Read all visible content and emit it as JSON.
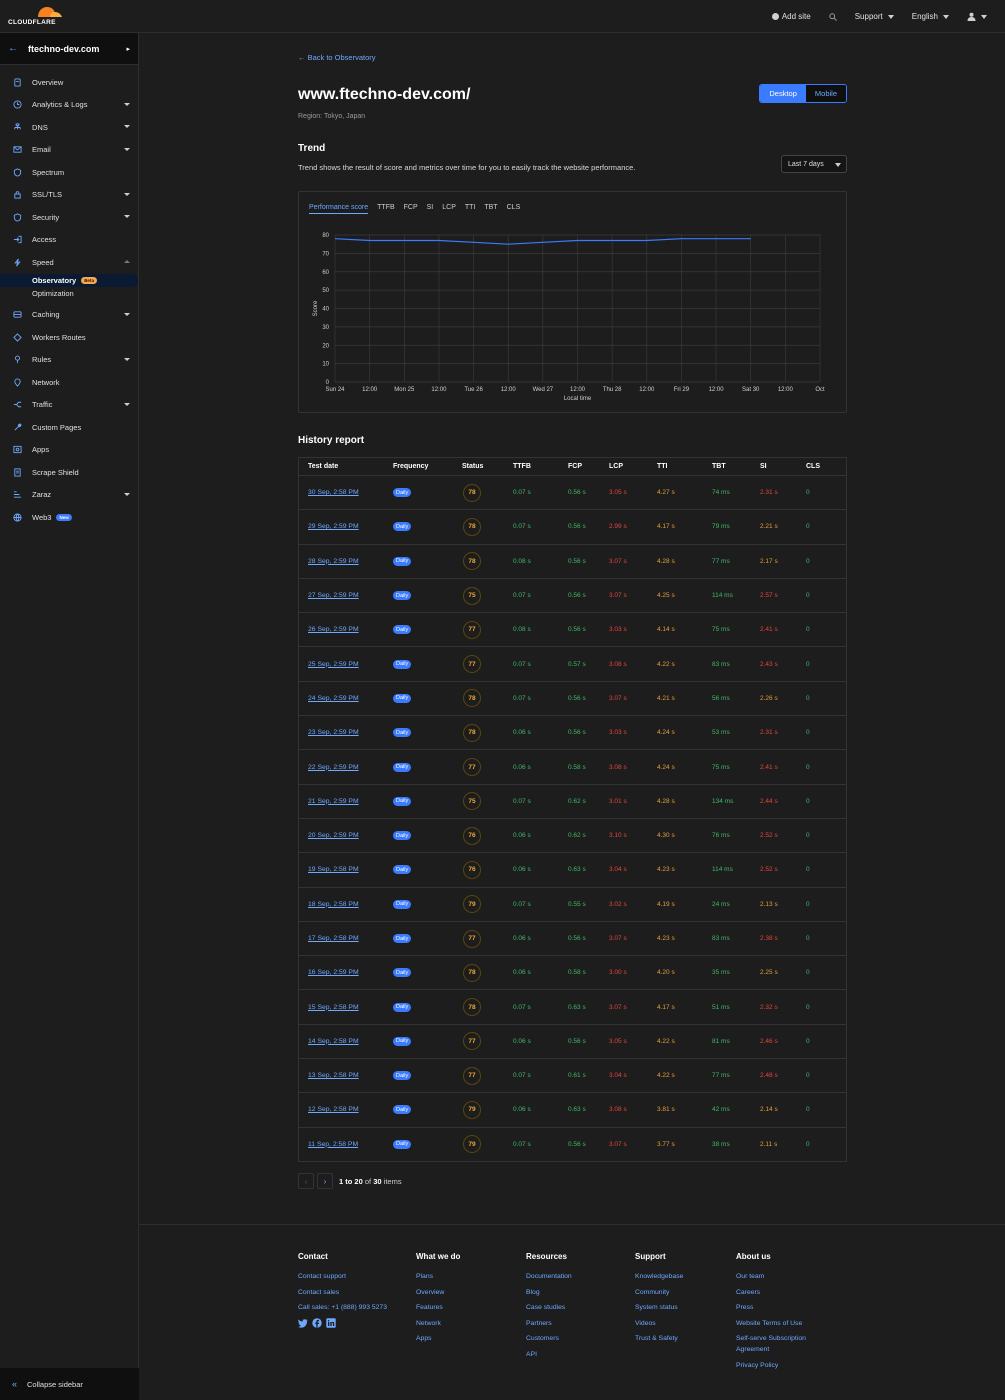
{
  "brand": {
    "logo_text": "CLOUDFLARE",
    "accent": "#f6821f",
    "link": "#6ea8ff",
    "primary": "#3a7bff"
  },
  "topbar": {
    "add_site": "Add site",
    "support": "Support",
    "language": "English"
  },
  "sidebar": {
    "zone": "ftechno-dev.com",
    "items": [
      {
        "label": "Overview",
        "icon": "document-icon",
        "dropdown": false
      },
      {
        "label": "Analytics & Logs",
        "icon": "clock-icon",
        "dropdown": true
      },
      {
        "label": "DNS",
        "icon": "network-tree-icon",
        "dropdown": true
      },
      {
        "label": "Email",
        "icon": "email-icon",
        "dropdown": true
      },
      {
        "label": "Spectrum",
        "icon": "shield-icon",
        "dropdown": false
      },
      {
        "label": "SSL/TLS",
        "icon": "lock-icon",
        "dropdown": true
      },
      {
        "label": "Security",
        "icon": "shield-icon",
        "dropdown": true
      },
      {
        "label": "Access",
        "icon": "access-icon",
        "dropdown": false
      },
      {
        "label": "Speed",
        "icon": "bolt-icon",
        "dropdown": "open"
      }
    ],
    "speed_sub": [
      {
        "label": "Observatory",
        "badge": "Beta",
        "active": true
      },
      {
        "label": "Optimization",
        "active": false
      }
    ],
    "items2": [
      {
        "label": "Caching",
        "icon": "storage-icon",
        "dropdown": true
      },
      {
        "label": "Workers Routes",
        "icon": "workers-icon",
        "dropdown": false
      },
      {
        "label": "Rules",
        "icon": "rules-icon",
        "dropdown": true
      },
      {
        "label": "Network",
        "icon": "pin-icon",
        "dropdown": false
      },
      {
        "label": "Traffic",
        "icon": "traffic-icon",
        "dropdown": true
      },
      {
        "label": "Custom Pages",
        "icon": "wrench-icon",
        "dropdown": false
      },
      {
        "label": "Apps",
        "icon": "apps-icon",
        "dropdown": false
      },
      {
        "label": "Scrape Shield",
        "icon": "scrape-icon",
        "dropdown": false
      },
      {
        "label": "Zaraz",
        "icon": "zaraz-icon",
        "dropdown": true
      },
      {
        "label": "Web3",
        "icon": "web3-icon",
        "dropdown": false,
        "badge": "New"
      }
    ],
    "collapse": "Collapse sidebar"
  },
  "page": {
    "back": "← Back to Observatory",
    "title": "www.ftechno-dev.com/",
    "region": "Region: Tokyo, Japan",
    "device_tabs": [
      "Desktop",
      "Mobile"
    ],
    "trend_title": "Trend",
    "trend_desc": "Trend shows the result of score and metrics over time for you to easily track the website performance.",
    "range": "Last 7 days",
    "history_title": "History report"
  },
  "chart_data": {
    "type": "line",
    "tabs": [
      "Performance score",
      "TTFB",
      "FCP",
      "SI",
      "LCP",
      "TTI",
      "TBT",
      "CLS"
    ],
    "selected_tab": "Performance score",
    "ylabel": "Score",
    "xlabel": "Local time",
    "ylim": [
      0,
      80
    ],
    "yticks": [
      0,
      10,
      20,
      30,
      40,
      50,
      60,
      70,
      80
    ],
    "xticks": [
      "Sun 24",
      "12:00",
      "Mon 25",
      "12:00",
      "Tue 26",
      "12:00",
      "Wed 27",
      "12:00",
      "Thu 28",
      "12:00",
      "Fri 29",
      "12:00",
      "Sat 30",
      "12:00",
      "Oct"
    ],
    "series": [
      {
        "x": [
          0,
          0.5,
          1,
          1.5,
          2,
          2.5,
          3,
          3.5,
          4,
          4.5,
          5,
          5.5,
          6
        ],
        "values": [
          78,
          77,
          77,
          77,
          76,
          75,
          76,
          77,
          77,
          77,
          78,
          78,
          78
        ]
      }
    ],
    "grid": true
  },
  "table": {
    "headers": [
      "Test date",
      "Frequency",
      "Status",
      "TTFB",
      "FCP",
      "LCP",
      "TTI",
      "TBT",
      "SI",
      "CLS"
    ],
    "rows": [
      {
        "date": "30 Sep, 2:58 PM",
        "freq": "Daily",
        "score": "78",
        "ttfb": "0.07 s",
        "fcp": "0.56 s",
        "lcp": "3.05 s",
        "tti": "4.27 s",
        "tbt": "74 ms",
        "si": "2.31 s",
        "cls": "0",
        "tbt_c": "g",
        "si_c": "r"
      },
      {
        "date": "29 Sep, 2:59 PM",
        "freq": "Daily",
        "score": "78",
        "ttfb": "0.07 s",
        "fcp": "0.56 s",
        "lcp": "2.99 s",
        "tti": "4.17 s",
        "tbt": "79 ms",
        "si": "2.21 s",
        "cls": "0",
        "tbt_c": "g",
        "si_c": "o"
      },
      {
        "date": "28 Sep, 2:59 PM",
        "freq": "Daily",
        "score": "78",
        "ttfb": "0.08 s",
        "fcp": "0.56 s",
        "lcp": "3.07 s",
        "tti": "4.28 s",
        "tbt": "77 ms",
        "si": "2.17 s",
        "cls": "0",
        "tbt_c": "g",
        "si_c": "o"
      },
      {
        "date": "27 Sep, 2:59 PM",
        "freq": "Daily",
        "score": "75",
        "ttfb": "0.07 s",
        "fcp": "0.56 s",
        "lcp": "3.07 s",
        "tti": "4.25 s",
        "tbt": "114 ms",
        "si": "2.57 s",
        "cls": "0",
        "tbt_c": "g",
        "si_c": "r"
      },
      {
        "date": "26 Sep, 2:59 PM",
        "freq": "Daily",
        "score": "77",
        "ttfb": "0.08 s",
        "fcp": "0.56 s",
        "lcp": "3.03 s",
        "tti": "4.14 s",
        "tbt": "75 ms",
        "si": "2.41 s",
        "cls": "0",
        "tbt_c": "g",
        "si_c": "r"
      },
      {
        "date": "25 Sep, 2:59 PM",
        "freq": "Daily",
        "score": "77",
        "ttfb": "0.07 s",
        "fcp": "0.57 s",
        "lcp": "3.08 s",
        "tti": "4.22 s",
        "tbt": "83 ms",
        "si": "2.43 s",
        "cls": "0",
        "tbt_c": "g",
        "si_c": "r"
      },
      {
        "date": "24 Sep, 2:59 PM",
        "freq": "Daily",
        "score": "78",
        "ttfb": "0.07 s",
        "fcp": "0.56 s",
        "lcp": "3.07 s",
        "tti": "4.21 s",
        "tbt": "56 ms",
        "si": "2.26 s",
        "cls": "0",
        "tbt_c": "g",
        "si_c": "o"
      },
      {
        "date": "23 Sep, 2:59 PM",
        "freq": "Daily",
        "score": "78",
        "ttfb": "0.06 s",
        "fcp": "0.56 s",
        "lcp": "3.03 s",
        "tti": "4.24 s",
        "tbt": "53 ms",
        "si": "2.31 s",
        "cls": "0",
        "tbt_c": "g",
        "si_c": "r"
      },
      {
        "date": "22 Sep, 2:59 PM",
        "freq": "Daily",
        "score": "77",
        "ttfb": "0.06 s",
        "fcp": "0.58 s",
        "lcp": "3.08 s",
        "tti": "4.24 s",
        "tbt": "75 ms",
        "si": "2.41 s",
        "cls": "0",
        "tbt_c": "g",
        "si_c": "r"
      },
      {
        "date": "21 Sep, 2:59 PM",
        "freq": "Daily",
        "score": "75",
        "ttfb": "0.07 s",
        "fcp": "0.62 s",
        "lcp": "3.01 s",
        "tti": "4.28 s",
        "tbt": "134 ms",
        "si": "2.44 s",
        "cls": "0",
        "tbt_c": "g",
        "si_c": "r"
      },
      {
        "date": "20 Sep, 2:59 PM",
        "freq": "Daily",
        "score": "76",
        "ttfb": "0.06 s",
        "fcp": "0.62 s",
        "lcp": "3.10 s",
        "tti": "4.30 s",
        "tbt": "76 ms",
        "si": "2.52 s",
        "cls": "0",
        "tbt_c": "g",
        "si_c": "r"
      },
      {
        "date": "19 Sep, 2:58 PM",
        "freq": "Daily",
        "score": "76",
        "ttfb": "0.06 s",
        "fcp": "0.63 s",
        "lcp": "3.04 s",
        "tti": "4.23 s",
        "tbt": "114 ms",
        "si": "2.52 s",
        "cls": "0",
        "tbt_c": "g",
        "si_c": "r"
      },
      {
        "date": "18 Sep, 2:58 PM",
        "freq": "Daily",
        "score": "79",
        "ttfb": "0.07 s",
        "fcp": "0.55 s",
        "lcp": "3.02 s",
        "tti": "4.19 s",
        "tbt": "24 ms",
        "si": "2.13 s",
        "cls": "0",
        "tbt_c": "g",
        "si_c": "o"
      },
      {
        "date": "17 Sep, 2:58 PM",
        "freq": "Daily",
        "score": "77",
        "ttfb": "0.06 s",
        "fcp": "0.56 s",
        "lcp": "3.07 s",
        "tti": "4.23 s",
        "tbt": "83 ms",
        "si": "2.38 s",
        "cls": "0",
        "tbt_c": "g",
        "si_c": "r"
      },
      {
        "date": "16 Sep, 2:59 PM",
        "freq": "Daily",
        "score": "78",
        "ttfb": "0.06 s",
        "fcp": "0.58 s",
        "lcp": "3.00 s",
        "tti": "4.20 s",
        "tbt": "35 ms",
        "si": "2.25 s",
        "cls": "0",
        "tbt_c": "g",
        "si_c": "o"
      },
      {
        "date": "15 Sep, 2:58 PM",
        "freq": "Daily",
        "score": "78",
        "ttfb": "0.07 s",
        "fcp": "0.63 s",
        "lcp": "3.07 s",
        "tti": "4.17 s",
        "tbt": "51 ms",
        "si": "2.32 s",
        "cls": "0",
        "tbt_c": "g",
        "si_c": "r"
      },
      {
        "date": "14 Sep, 2:58 PM",
        "freq": "Daily",
        "score": "77",
        "ttfb": "0.06 s",
        "fcp": "0.56 s",
        "lcp": "3.05 s",
        "tti": "4.22 s",
        "tbt": "81 ms",
        "si": "2.46 s",
        "cls": "0",
        "tbt_c": "g",
        "si_c": "r"
      },
      {
        "date": "13 Sep, 2:58 PM",
        "freq": "Daily",
        "score": "77",
        "ttfb": "0.07 s",
        "fcp": "0.61 s",
        "lcp": "3.04 s",
        "tti": "4.22 s",
        "tbt": "77 ms",
        "si": "2.48 s",
        "cls": "0",
        "tbt_c": "g",
        "si_c": "r"
      },
      {
        "date": "12 Sep, 2:58 PM",
        "freq": "Daily",
        "score": "79",
        "ttfb": "0.06 s",
        "fcp": "0.63 s",
        "lcp": "3.08 s",
        "tti": "3.81 s",
        "tbt": "42 ms",
        "si": "2.14 s",
        "cls": "0",
        "tbt_c": "g",
        "si_c": "o"
      },
      {
        "date": "11 Sep, 2:58 PM",
        "freq": "Daily",
        "score": "79",
        "ttfb": "0.07 s",
        "fcp": "0.56 s",
        "lcp": "3.07 s",
        "tti": "3.77 s",
        "tbt": "38 ms",
        "si": "2.11 s",
        "cls": "0",
        "tbt_c": "g",
        "si_c": "o"
      }
    ]
  },
  "pager": {
    "range": "1 to 20",
    "of": "of",
    "total": "30",
    "suffix": "items"
  },
  "footer": {
    "columns": [
      {
        "title": "Contact",
        "links": [
          "Contact support",
          "Contact sales",
          "Call sales: +1 (888) 993 5273"
        ],
        "social": true
      },
      {
        "title": "What we do",
        "links": [
          "Plans",
          "Overview",
          "Features",
          "Network",
          "Apps"
        ]
      },
      {
        "title": "Resources",
        "links": [
          "Documentation",
          "Blog",
          "Case studies",
          "Partners",
          "Customers",
          "API"
        ]
      },
      {
        "title": "Support",
        "links": [
          "Knowledgebase",
          "Community",
          "System status",
          "Videos",
          "Trust & Safety"
        ]
      },
      {
        "title": "About us",
        "links": [
          "Our team",
          "Careers",
          "Press",
          "Website Terms of Use",
          "Self-serve Subscription Agreement",
          "Privacy Policy"
        ]
      }
    ]
  }
}
